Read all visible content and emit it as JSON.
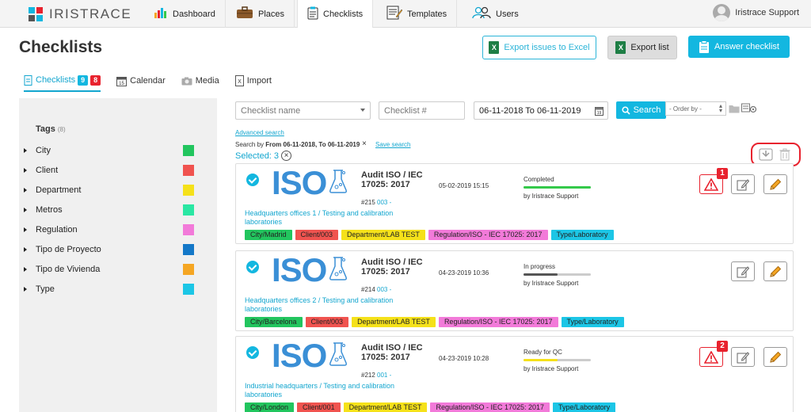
{
  "app": {
    "logo_text": "IRISTRACE",
    "user_name": "Iristrace Support"
  },
  "nav": {
    "tabs": [
      {
        "label": "Dashboard",
        "icon": "chart-icon"
      },
      {
        "label": "Places",
        "icon": "briefcase-icon"
      },
      {
        "label": "Checklists",
        "icon": "clipboard-icon"
      },
      {
        "label": "Templates",
        "icon": "template-icon"
      },
      {
        "label": "Users",
        "icon": "users-icon"
      }
    ],
    "active": "Checklists"
  },
  "page": {
    "title": "Checklists",
    "export_issues_label": "Export issues to Excel",
    "export_list_label": "Export list",
    "answer_label": "Answer checklist"
  },
  "subtabs": {
    "checklists": {
      "label": "Checklists",
      "badge_blue": "9",
      "badge_red": "8"
    },
    "calendar": "Calendar",
    "media": "Media",
    "import": "Import"
  },
  "sidebar": {
    "tags_title": "Tags",
    "tags_count": "(8)",
    "tags": [
      {
        "label": "City",
        "color": "#22c55e"
      },
      {
        "label": "Client",
        "color": "#f0534f"
      },
      {
        "label": "Department",
        "color": "#f5e11a"
      },
      {
        "label": "Metros",
        "color": "#2ae7a3"
      },
      {
        "label": "Regulation",
        "color": "#f27ad9"
      },
      {
        "label": "Tipo de Proyecto",
        "color": "#1478c8"
      },
      {
        "label": "Tipo de Vivienda",
        "color": "#f5a623"
      },
      {
        "label": "Type",
        "color": "#1cc6e6"
      }
    ]
  },
  "filters": {
    "name_placeholder": "Checklist name",
    "number_placeholder": "Checklist #",
    "date_range": "06-11-2018 To 06-11-2019",
    "search_label": "Search",
    "order_by": "- Order by -",
    "advanced_search": "Advanced search",
    "search_by_prefix": "Search by",
    "search_by_value": "From 06-11-2018, To 06-11-2019",
    "save_search": "Save search",
    "selected": "Selected: 3"
  },
  "checklists": [
    {
      "iso": "ISO",
      "title": "Audit ISO / IEC 17025: 2017",
      "number": "#215",
      "code": "003 -",
      "date": "05-02-2019 15:15",
      "status": "Completed",
      "progress": 1.0,
      "bar_color": "#34c94a",
      "by": "by Iristrace Support",
      "location": "Headquarters offices 1 / Testing and calibration laboratories",
      "issues": "1",
      "chips": [
        {
          "label": "City/Madrid",
          "color": "#22c55e"
        },
        {
          "label": "Client/003",
          "color": "#f0534f"
        },
        {
          "label": "Department/LAB TEST",
          "color": "#f5e11a"
        },
        {
          "label": "Regulation/ISO - IEC 17025: 2017",
          "color": "#f27ad9"
        },
        {
          "label": "Type/Laboratory",
          "color": "#1cc6e6"
        }
      ]
    },
    {
      "iso": "ISO",
      "title": "Audit ISO / IEC 17025: 2017",
      "number": "#214",
      "code": "003 -",
      "date": "04-23-2019 10:36",
      "status": "In progress",
      "progress": 0.5,
      "bar_color": "#555555",
      "by": "by Iristrace Support",
      "location": "Headquarters offices 2 / Testing and calibration laboratories",
      "issues": "",
      "chips": [
        {
          "label": "City/Barcelona",
          "color": "#22c55e"
        },
        {
          "label": "Client/003",
          "color": "#f0534f"
        },
        {
          "label": "Department/LAB TEST",
          "color": "#f5e11a"
        },
        {
          "label": "Regulation/ISO - IEC 17025: 2017",
          "color": "#f27ad9"
        },
        {
          "label": "Type/Laboratory",
          "color": "#1cc6e6"
        }
      ]
    },
    {
      "iso": "ISO",
      "title": "Audit ISO / IEC 17025: 2017",
      "number": "#212",
      "code": "001 -",
      "date": "04-23-2019 10:28",
      "status": "Ready for QC",
      "progress": 0.5,
      "bar_color": "#f5e11a",
      "by": "by Iristrace Support",
      "location": "Industrial headquarters / Testing and calibration laboratories",
      "issues": "2",
      "chips": [
        {
          "label": "City/London",
          "color": "#22c55e"
        },
        {
          "label": "Client/001",
          "color": "#f0534f"
        },
        {
          "label": "Department/LAB TEST",
          "color": "#f5e11a"
        },
        {
          "label": "Regulation/ISO - IEC 17025: 2017",
          "color": "#f27ad9"
        },
        {
          "label": "Type/Laboratory",
          "color": "#1cc6e6"
        }
      ]
    }
  ]
}
